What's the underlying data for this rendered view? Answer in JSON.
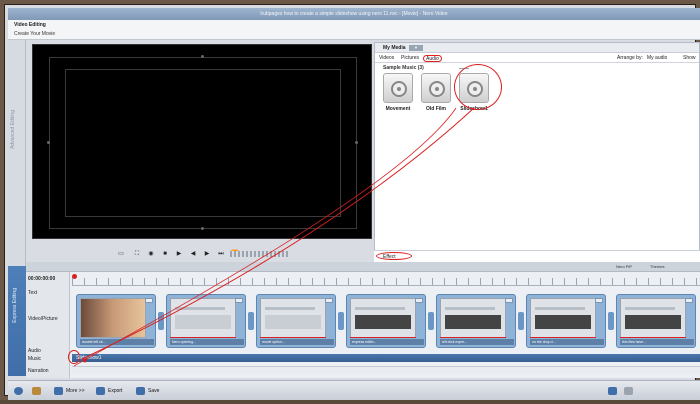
{
  "window": {
    "title": "hubpages how to create a simple slideshow using nero 11.nvc - [Movie] - Nero Video"
  },
  "header": {
    "title": "Video Editing",
    "subtitle": "Create Your Movie"
  },
  "left_strip": {
    "top_label": "Advanced Editing",
    "bottom_label": "Express Editing"
  },
  "preview_controls": {
    "icons": [
      "monitor-icon",
      "crop-icon",
      "snapshot-icon",
      "stop-icon",
      "play-icon",
      "step-back-icon",
      "step-forward-icon",
      "next-icon",
      "fastforward-icon"
    ]
  },
  "media_panel": {
    "title": "My Media",
    "tabs": [
      {
        "label": "Videos"
      },
      {
        "label": "Pictures"
      },
      {
        "label": "Audio"
      }
    ],
    "arrange_label": "Arrange by:",
    "arrange_value": "My audio",
    "show_label": "Show",
    "group_label": "Sample Music (3)",
    "items": [
      {
        "label": "Movement"
      },
      {
        "label": "Old Film"
      },
      {
        "label": "Slideshow1"
      }
    ],
    "effect_feature": "Effect Feature"
  },
  "timeline_header": {
    "buttons": [
      "Nero PiP",
      "Themes"
    ]
  },
  "timeline": {
    "timecode": "00:00:00:00",
    "tracks": [
      "Text",
      "Video/Picture",
      "Audio",
      "Music",
      "Narration"
    ],
    "ruler_marks": [
      "",
      "",
      "",
      "",
      "",
      "",
      ""
    ],
    "clips": [
      {
        "caption": "double left cli..."
      },
      {
        "caption": "Nero opening..."
      },
      {
        "caption": "movie option..."
      },
      {
        "caption": "express editin..."
      },
      {
        "caption": "left click expre..."
      },
      {
        "caption": "on the drop d..."
      },
      {
        "caption": "this files have..."
      },
      {
        "caption": "..."
      }
    ],
    "music_clip": "Slideshow1"
  },
  "bottom_bar": {
    "more_label": "More >>",
    "export_label": "Export",
    "save_label": "Save"
  },
  "colors": {
    "accent": "#3f6ea8",
    "annotation": "#d82020"
  }
}
